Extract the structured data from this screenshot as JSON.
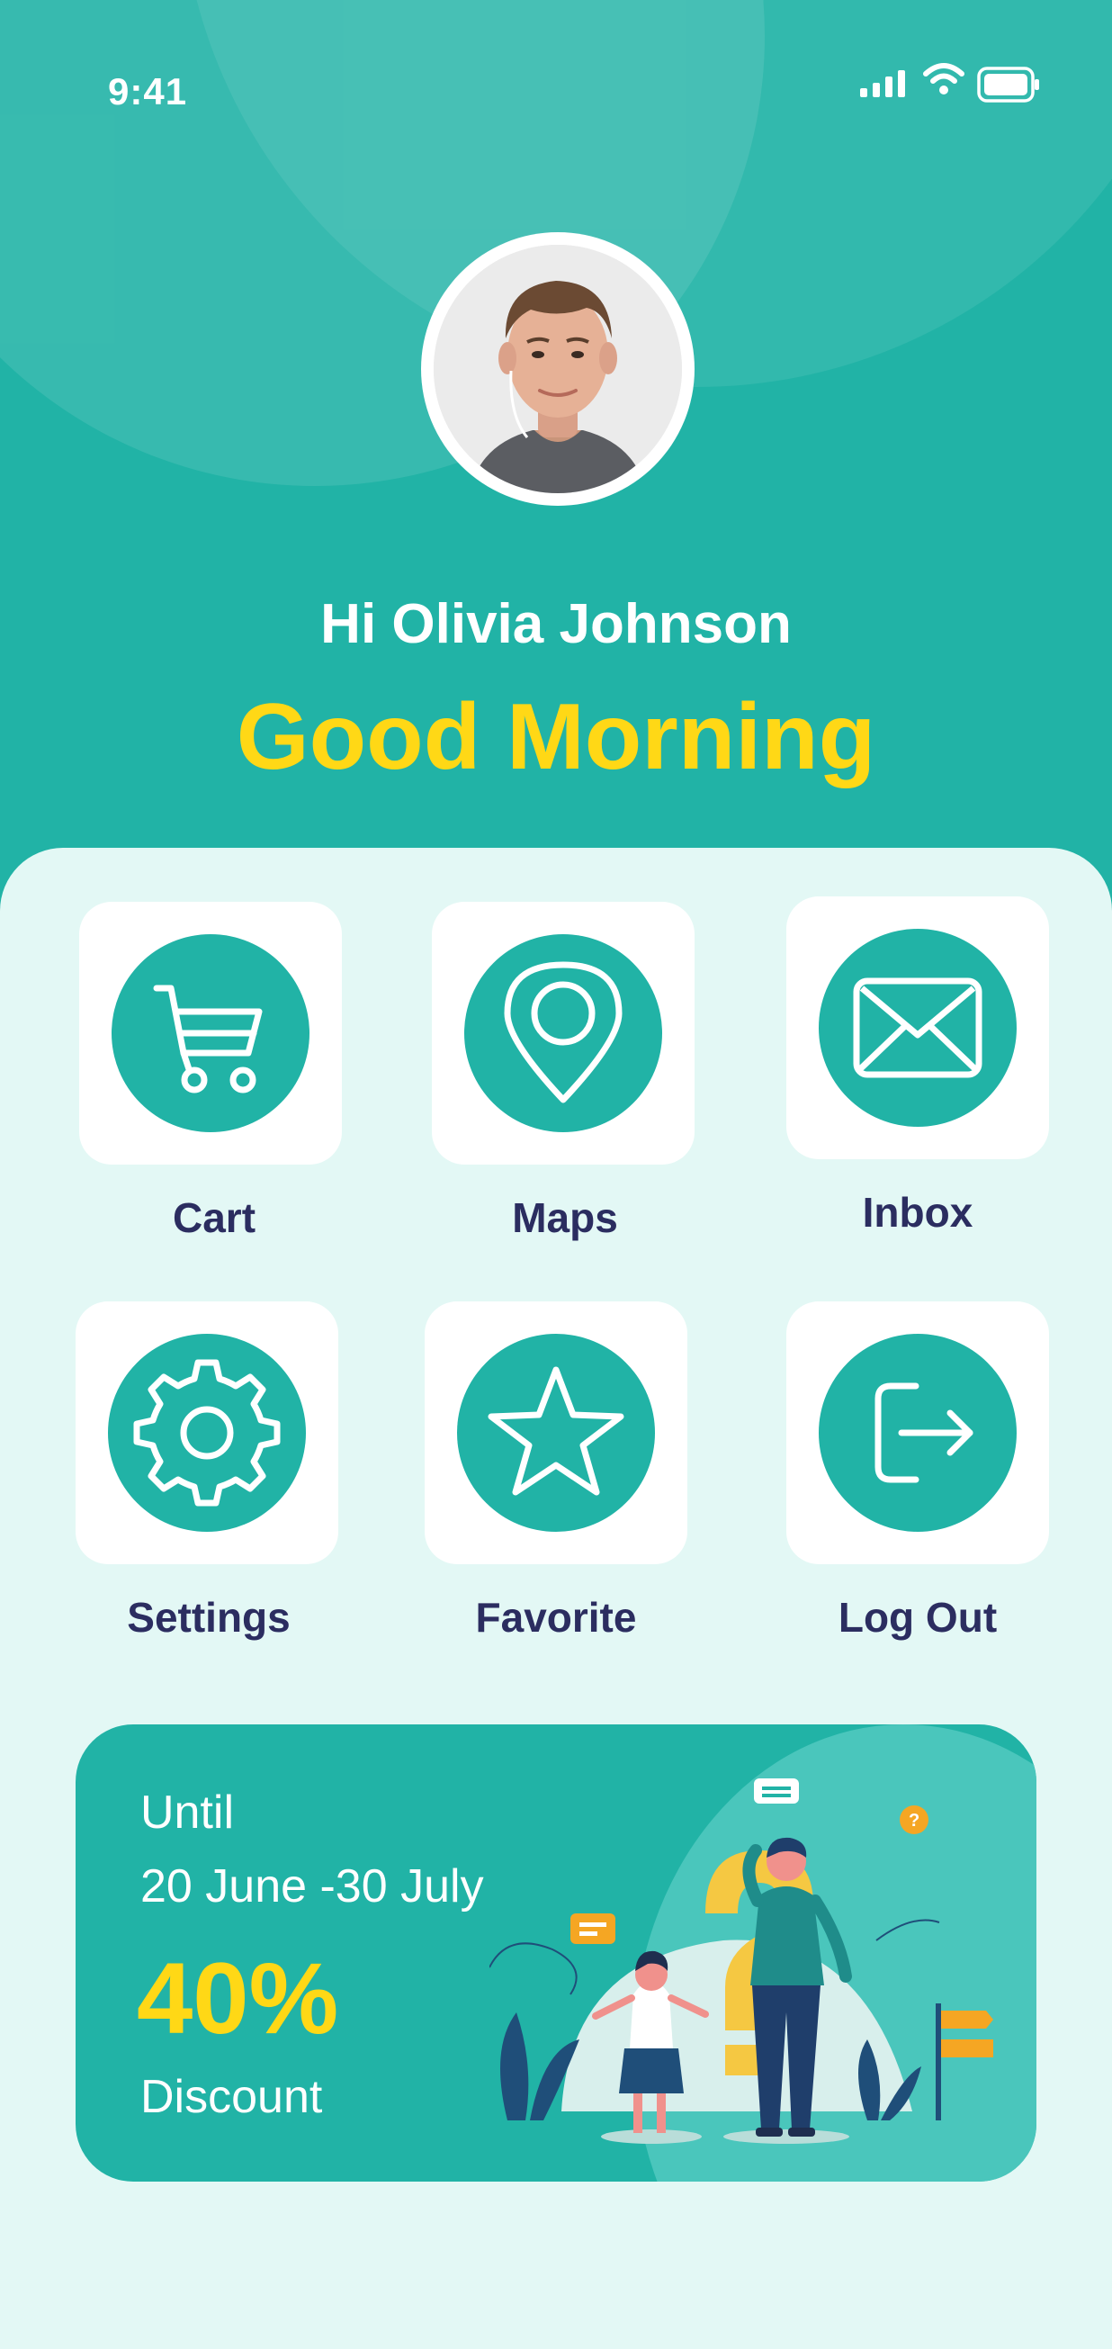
{
  "status_bar": {
    "time": "9:41"
  },
  "profile": {
    "greeting": "Hi Olivia Johnson",
    "salutation": "Good Morning"
  },
  "menu": [
    {
      "label": "Cart",
      "icon": "cart-icon"
    },
    {
      "label": "Maps",
      "icon": "map-pin-icon"
    },
    {
      "label": "Inbox",
      "icon": "mail-icon"
    },
    {
      "label": "Settings",
      "icon": "gear-icon"
    },
    {
      "label": "Favorite",
      "icon": "star-icon"
    },
    {
      "label": "Log Out",
      "icon": "logout-icon"
    }
  ],
  "promo": {
    "line1": "Until",
    "dates": "20 June -30 July",
    "percent": "40%",
    "label": "Discount"
  },
  "colors": {
    "primary": "#21b3a6",
    "accent": "#ffd816",
    "label_text": "#2b2d60",
    "background": "#e3f8f5"
  }
}
